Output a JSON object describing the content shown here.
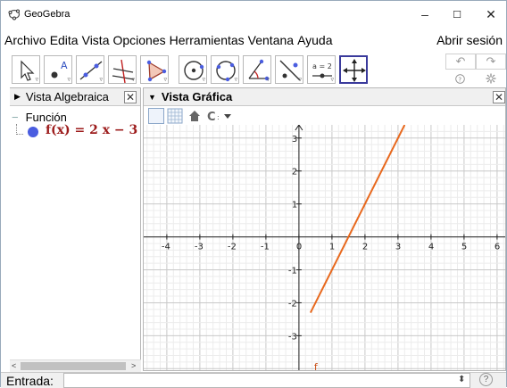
{
  "window": {
    "title": "GeoGebra",
    "controls": {
      "minimize": "–",
      "maximize": "☐",
      "close": "✕"
    }
  },
  "menu": {
    "items": [
      "Archivo",
      "Edita",
      "Vista",
      "Opciones",
      "Herramientas",
      "Ventana",
      "Ayuda"
    ],
    "sign_in": "Abrir sesión"
  },
  "toolbar": {
    "tools": [
      {
        "name": "move-tool-icon"
      },
      {
        "name": "point-tool-icon",
        "label": "A"
      },
      {
        "name": "line-tool-icon"
      },
      {
        "name": "perpendicular-tool-icon"
      },
      {
        "name": "polygon-tool-icon"
      },
      {
        "name": "circle-tool-icon"
      },
      {
        "name": "circle-three-points-tool-icon"
      },
      {
        "name": "angle-tool-icon"
      },
      {
        "name": "reflect-tool-icon"
      },
      {
        "name": "slider-tool-icon",
        "label": "a = 2"
      },
      {
        "name": "move-graphics-view-tool-icon"
      }
    ],
    "undo": "↶",
    "redo": "↷",
    "help_icon": "?",
    "settings_icon": "gear-icon"
  },
  "algebra_view": {
    "title": "Vista Algebraica",
    "close": "✕",
    "category": "Función",
    "function": "f(x) = 2 x − 3",
    "dot_color": "#4a5de0"
  },
  "graphics_view": {
    "title": "Vista Gráfica",
    "close": "✕",
    "function_label": "f",
    "line_color": "#e8691e"
  },
  "chart_data": {
    "type": "line",
    "function": "f(x) = 2x - 3",
    "slope": 2,
    "intercept": -3,
    "x_ticks": [
      -4,
      -3,
      -2,
      -1,
      0,
      1,
      2,
      3,
      4,
      5,
      6
    ],
    "y_ticks": [
      -3,
      -2,
      -1,
      1,
      2,
      3
    ],
    "xlim": [
      -4.7,
      6.3
    ],
    "ylim": [
      -4.1,
      3.4
    ],
    "grid": true,
    "series": [
      {
        "name": "f",
        "x": [
          0.35,
          3.2
        ],
        "y": [
          -2.3,
          3.4
        ]
      }
    ]
  },
  "input_bar": {
    "label": "Entrada:",
    "value": "",
    "help": "?"
  }
}
